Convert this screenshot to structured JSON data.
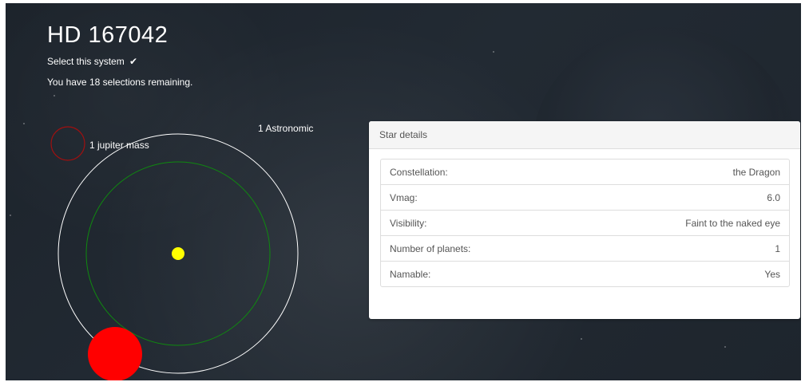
{
  "system": {
    "name": "HD 167042",
    "select_label": "Select this system",
    "select_icon": "checkmark-icon",
    "remaining_text": "You have 18 selections remaining."
  },
  "orbit_view": {
    "orbit_label": "1 Astronomic",
    "mass_label": "1 jupiter mass",
    "colors": {
      "star": "#ffff00",
      "planet": "#ff0000",
      "orbit_ring": "#ffffff",
      "habitable_zone": "#0f8a0f",
      "mass_reference": "#a01010"
    }
  },
  "star_details": {
    "heading": "Star details",
    "rows": [
      {
        "label": "Constellation:",
        "value": "the Dragon"
      },
      {
        "label": "Vmag:",
        "value": "6.0"
      },
      {
        "label": "Visibility:",
        "value": "Faint to the naked eye"
      },
      {
        "label": "Number of planets:",
        "value": "1"
      },
      {
        "label": "Namable:",
        "value": "Yes"
      }
    ]
  }
}
